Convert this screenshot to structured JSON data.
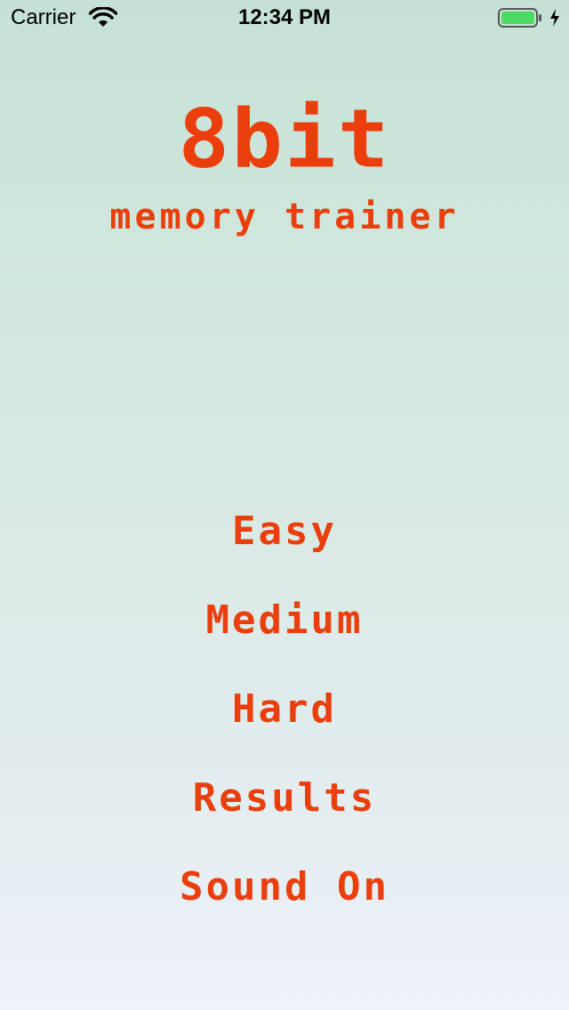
{
  "status_bar": {
    "carrier": "Carrier",
    "time": "12:34 PM",
    "battery_color": "#4cd964"
  },
  "title": {
    "main": "8bit",
    "sub": "memory trainer"
  },
  "menu": {
    "easy": "Easy",
    "medium": "Medium",
    "hard": "Hard",
    "results": "Results",
    "sound": "Sound On"
  },
  "theme": {
    "accent": "#ea3f0c"
  }
}
